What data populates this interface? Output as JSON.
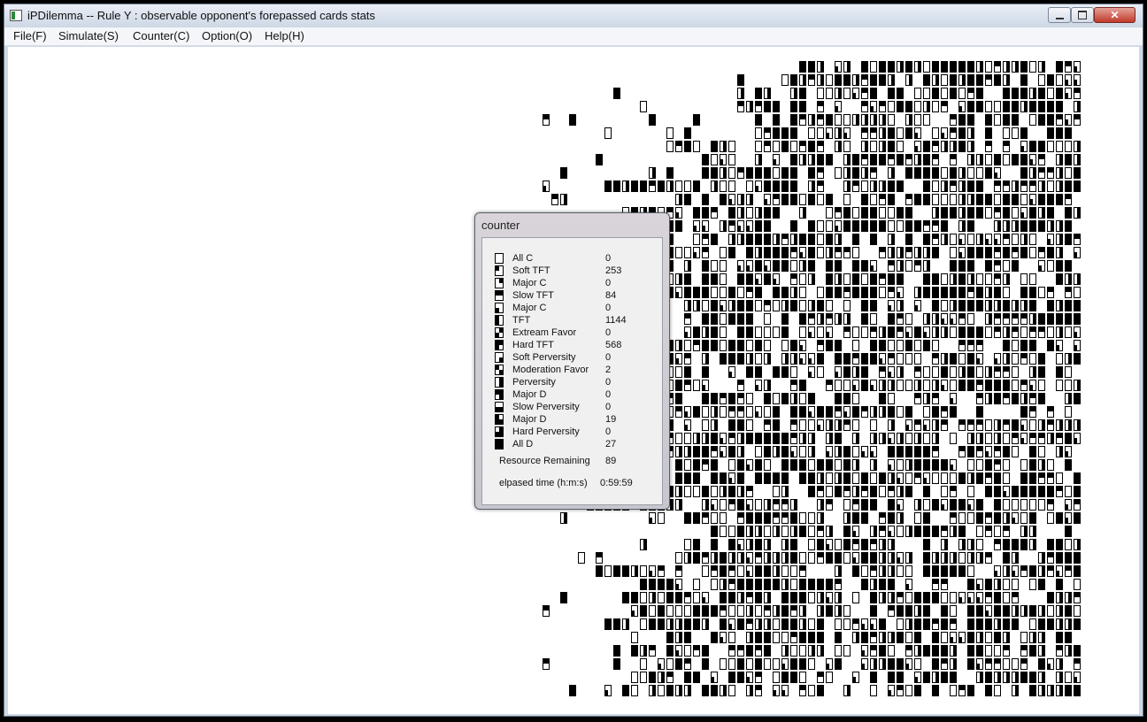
{
  "window": {
    "title": "iPDilemma -- Rule Y : observable opponent's forepassed cards stats",
    "close_glyph": "✕"
  },
  "menu": {
    "items": [
      {
        "label": "File(F)",
        "name": "menu-file"
      },
      {
        "label": "Simulate(S)",
        "name": "menu-simulate"
      },
      {
        "label": "Counter(C)",
        "name": "menu-counter"
      },
      {
        "label": "Option(O)",
        "name": "menu-option"
      },
      {
        "label": "Help(H)",
        "name": "menu-help"
      }
    ]
  },
  "counter_dialog": {
    "title": "counter",
    "strategies": [
      {
        "label": "All C",
        "value": "0",
        "pattern": "0000"
      },
      {
        "label": "Soft TFT",
        "value": "253",
        "pattern": "1000"
      },
      {
        "label": "Major C",
        "value": "0",
        "pattern": "0100"
      },
      {
        "label": "Slow TFT",
        "value": "84",
        "pattern": "1100"
      },
      {
        "label": "Major C",
        "value": "0",
        "pattern": "0010"
      },
      {
        "label": "TFT",
        "value": "1144",
        "pattern": "1010"
      },
      {
        "label": "Extream Favor",
        "value": "0",
        "pattern": "0110"
      },
      {
        "label": "Hard TFT",
        "value": "568",
        "pattern": "1110"
      },
      {
        "label": "Soft Perversity",
        "value": "0",
        "pattern": "0001"
      },
      {
        "label": "Moderation Favor",
        "value": "2",
        "pattern": "1001"
      },
      {
        "label": "Perversity",
        "value": "0",
        "pattern": "0101"
      },
      {
        "label": "Major D",
        "value": "0",
        "pattern": "1101"
      },
      {
        "label": "Slow Perversity",
        "value": "0",
        "pattern": "0011"
      },
      {
        "label": "Major D",
        "value": "19",
        "pattern": "1011"
      },
      {
        "label": "Hard Perversity",
        "value": "0",
        "pattern": "0111"
      },
      {
        "label": "All D",
        "value": "27",
        "pattern": "1111"
      }
    ],
    "resource_label": "Resource Remaining",
    "resource_value": "89",
    "elapsed_label": "elpased time (h:m:s)",
    "elapsed_value": "0:59:59"
  }
}
